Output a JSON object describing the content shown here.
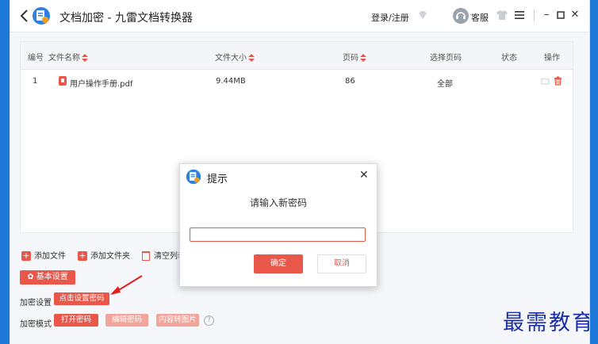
{
  "window": {
    "title": "文档加密 - 九雷文档转换器",
    "login_label": "登录/注册",
    "service_label": "客服"
  },
  "table": {
    "headers": [
      "编号",
      "文件名称",
      "文件大小",
      "页码",
      "选择页码",
      "状态",
      "操作"
    ],
    "rows": [
      {
        "index": "1",
        "filename": "用户操作手册.pdf",
        "size": "9.44MB",
        "pages": "86",
        "page_selection": "全部",
        "status": ""
      }
    ]
  },
  "toolbar": {
    "add_file": "添加文件",
    "add_folder": "添加文件夹",
    "clear_list": "清空列表"
  },
  "settings": {
    "basic_label": "基本设置",
    "encrypt_settings_label": "加密设置",
    "set_password_button": "点击设置密码",
    "encrypt_mode_label": "加密模式",
    "mode_buttons": [
      "打开密码",
      "编辑密码",
      "内容转图片"
    ]
  },
  "dialog": {
    "title": "提示",
    "prompt": "请输入新密码",
    "input_value": "",
    "ok_label": "确定",
    "cancel_label": "取消"
  },
  "watermark": "最需教育",
  "colors": {
    "accent": "#e8574a",
    "accent_light": "#f3a49b",
    "desktop": "#1e78d8",
    "watermark": "#1b2fa8"
  }
}
